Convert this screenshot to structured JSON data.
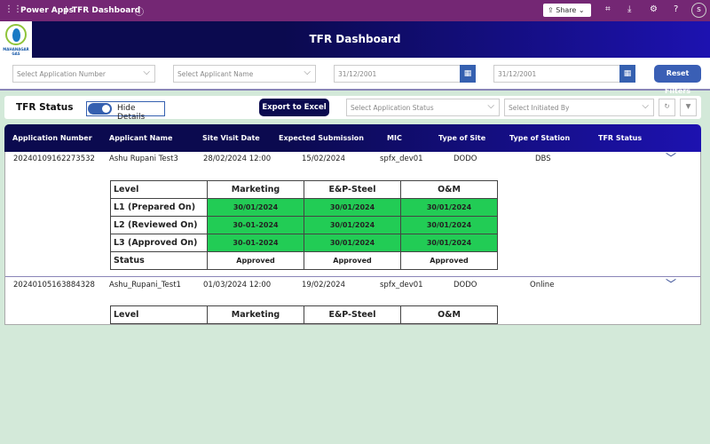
{
  "topbar": {
    "app": "Power Apps",
    "sep": "|",
    "page": "TFR Dashboard",
    "share": "Share",
    "avatar": "s"
  },
  "header": {
    "title": "TFR Dashboard",
    "logo_text": "MAHANAGAR GAS"
  },
  "filters": {
    "app_number": "Select Application Number",
    "applicant": "Select Applicant Name",
    "date_from": "31/12/2001",
    "date_to": "31/12/2001",
    "reset": "Reset Filters"
  },
  "panel": {
    "title": "TFR Status",
    "toggle": "Hide Details",
    "export": "Export to Excel",
    "status": "Select Application Status",
    "initiated": "Select Initiated By"
  },
  "columns": [
    "Application Number",
    "Applicant Name",
    "Site Visit Date",
    "Expected Submission",
    "MIC",
    "Type of Site",
    "Type of Station",
    "TFR Status"
  ],
  "rows": [
    {
      "app": "20240109162273532",
      "name": "Ashu Rupani Test3",
      "visit": "28/02/2024 12:00",
      "expected": "15/02/2024",
      "mic": "spfx_dev01",
      "site": "DODO",
      "station": "DBS",
      "detail": {
        "head": [
          "Level",
          "Marketing",
          "E&P-Steel",
          "O&M"
        ],
        "l1": [
          "L1 (Prepared On)",
          "30/01/2024",
          "30/01/2024",
          "30/01/2024"
        ],
        "l2": [
          "L2 (Reviewed On)",
          "30-01-2024",
          "30/01/2024",
          "30/01/2024"
        ],
        "l3": [
          "L3 (Approved On)",
          "30-01-2024",
          "30/01/2024",
          "30/01/2024"
        ],
        "status": [
          "Status",
          "Approved",
          "Approved",
          "Approved"
        ]
      }
    },
    {
      "app": "20240105163884328",
      "name": "Ashu_Rupani_Test1",
      "visit": "01/03/2024 12:00",
      "expected": "19/02/2024",
      "mic": "spfx_dev01",
      "site": "DODO",
      "station": "Online",
      "detail": {
        "head": [
          "Level",
          "Marketing",
          "E&P-Steel",
          "O&M"
        ]
      }
    }
  ]
}
